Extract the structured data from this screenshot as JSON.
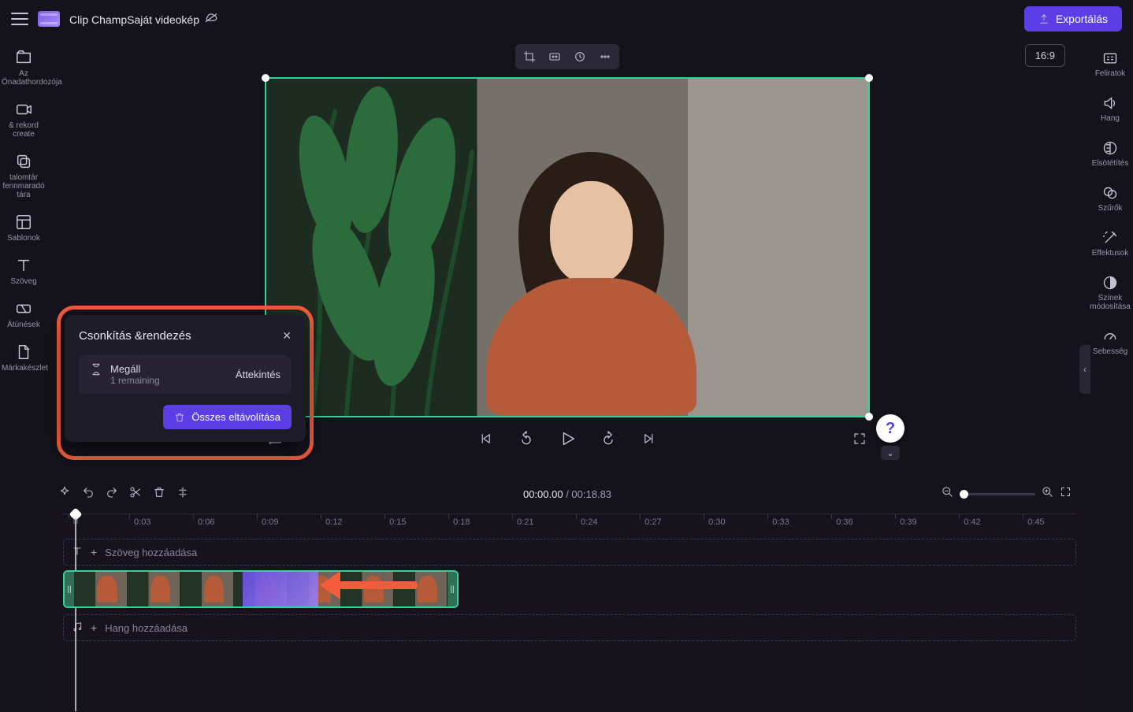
{
  "header": {
    "app_name": "Clip Champ",
    "project_name": "Saját videokép",
    "export_label": "Exportálás",
    "aspect_label": "16:9"
  },
  "left_rail": [
    {
      "id": "media",
      "label": "Az Önadathordozója"
    },
    {
      "id": "record",
      "label": "&amp; rekord create"
    },
    {
      "id": "library",
      "label": "talomtár fennmaradó tára"
    },
    {
      "id": "templates",
      "label": "Sablonok"
    },
    {
      "id": "text",
      "label": "Szöveg"
    },
    {
      "id": "transitions",
      "label": "Átúnések"
    },
    {
      "id": "brandkit",
      "label": "Márkakészlet"
    }
  ],
  "right_rail": [
    {
      "id": "captions",
      "label": "Feliratok"
    },
    {
      "id": "audio",
      "label": "Hang"
    },
    {
      "id": "fade",
      "label": "Elsötétítés"
    },
    {
      "id": "filters",
      "label": "Szűrők"
    },
    {
      "id": "effects",
      "label": "Effektusok"
    },
    {
      "id": "colors",
      "label": "Színek módosítása"
    },
    {
      "id": "speed",
      "label": "Sebesség"
    }
  ],
  "time": {
    "current": "00:00.00",
    "duration": "00:18.83"
  },
  "ruler_ticks": [
    "0",
    "0:03",
    "0:06",
    "0:09",
    "0:12",
    "0:15",
    "0:18",
    "0:21",
    "0:24",
    "0:27",
    "0:30",
    "0:33",
    "0:36",
    "0:39",
    "0:42",
    "0:45"
  ],
  "lanes": {
    "text_add": "Szöveg hozzáadása",
    "audio_add": "Hang hozzáadása"
  },
  "popup": {
    "title": "Csonkítás &amp;rendezés",
    "item_label": "Megáll",
    "item_count": "1",
    "item_remaining": "remaining",
    "review": "Áttekintés",
    "remove_all": "Összes eltávolítása"
  },
  "help_badge": "?"
}
